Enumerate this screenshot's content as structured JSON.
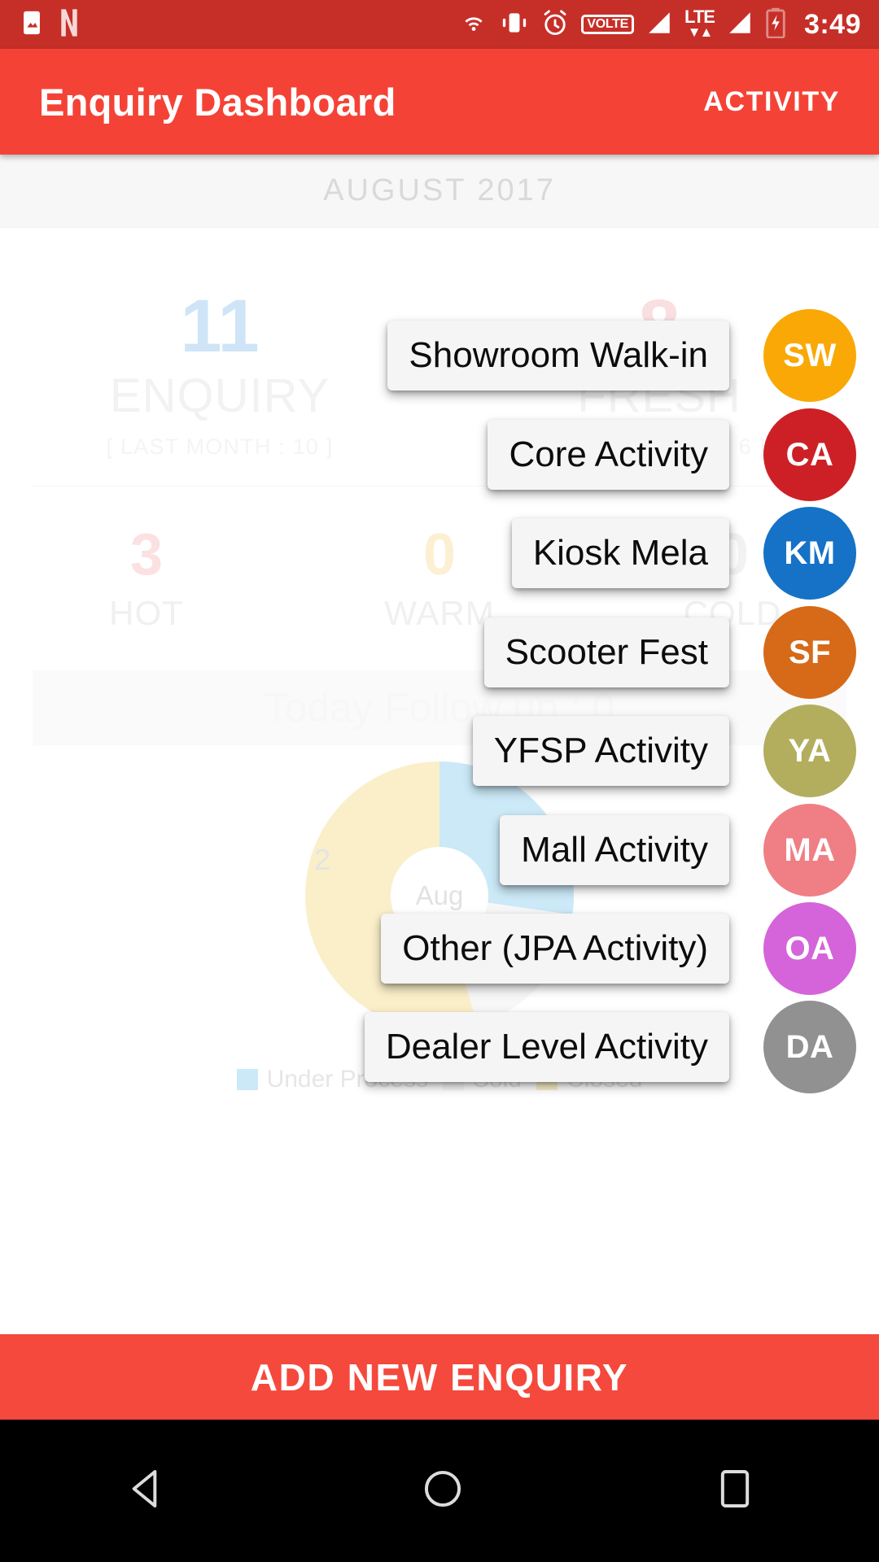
{
  "statusbar": {
    "time": "3:49",
    "icons_left": [
      "photos-icon",
      "netflix-icon"
    ],
    "icons_right": [
      "cast-icon",
      "vibrate-icon",
      "alarm-icon",
      "volte-icon",
      "signal-bars-icon",
      "lte-icon",
      "signal-bars-2-icon",
      "battery-charging-icon"
    ],
    "volte_label": "VOLTE",
    "lte_label": "LTE"
  },
  "appbar": {
    "title": "Enquiry Dashboard",
    "action_label": "ACTIVITY",
    "color": "#f44336"
  },
  "dashboard": {
    "month_label": "AUGUST 2017",
    "stats": [
      {
        "value": "11",
        "label": "ENQUIRY",
        "sub": "[ LAST MONTH : 10 ]",
        "color": "#cfe4f7"
      },
      {
        "value": "8",
        "label": "FRESH",
        "sub": "[ LAST MONTH : 6 ]",
        "color": "#fadfe0"
      }
    ],
    "temperature": [
      {
        "value": "3",
        "label": "HOT"
      },
      {
        "value": "0",
        "label": "WARM"
      },
      {
        "value": "0",
        "label": "COLD"
      }
    ],
    "followup_label": "Today Follow up : 0"
  },
  "chart_data": {
    "type": "pie",
    "title": "",
    "center_label": "Aug",
    "categories": [
      "Under Process",
      "Sold",
      "Closed"
    ],
    "values": [
      3,
      2,
      6
    ],
    "colors": [
      "#cbe9f7",
      "#f7f7f7",
      "#faefc9"
    ],
    "point_labels": [
      "2",
      "3"
    ],
    "legend": [
      "Under Process",
      "Sold",
      "Closed"
    ],
    "legend_position": "bottom",
    "grid": false
  },
  "menu": {
    "items": [
      {
        "label": "Showroom Walk-in",
        "initials": "SW",
        "color": "#f9a806"
      },
      {
        "label": "Core Activity",
        "initials": "CA",
        "color": "#cd2026"
      },
      {
        "label": "Kiosk Mela",
        "initials": "KM",
        "color": "#1572c6"
      },
      {
        "label": "Scooter Fest",
        "initials": "SF",
        "color": "#d66a18"
      },
      {
        "label": "YFSP Activity",
        "initials": "YA",
        "color": "#b3ae5e"
      },
      {
        "label": "Mall Activity",
        "initials": "MA",
        "color": "#ef7f84"
      },
      {
        "label": "Other (JPA Activity)",
        "initials": "OA",
        "color": "#d564da"
      },
      {
        "label": "Dealer Level Activity",
        "initials": "DA",
        "color": "#919191"
      }
    ]
  },
  "bottom_button": {
    "label": "ADD NEW ENQUIRY",
    "color": "#f4493c"
  },
  "navbar": {
    "back": "back-triangle-icon",
    "home": "home-circle-icon",
    "recents": "recents-square-icon"
  }
}
